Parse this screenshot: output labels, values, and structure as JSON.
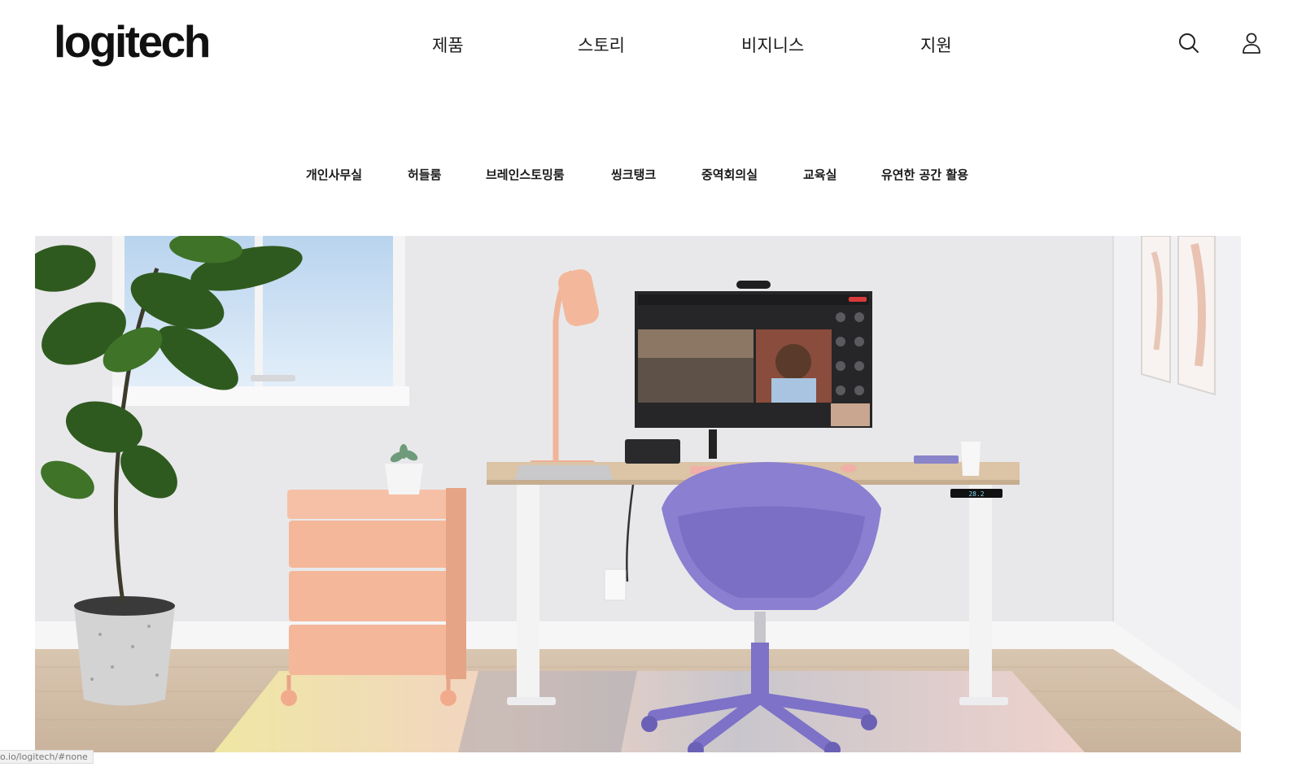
{
  "brand": {
    "logo_text": "logitech"
  },
  "main_nav": {
    "items": [
      {
        "label": "제품"
      },
      {
        "label": "스토리"
      },
      {
        "label": "비지니스"
      },
      {
        "label": "지원"
      }
    ]
  },
  "header_icons": {
    "search": "search-icon",
    "account": "user-icon"
  },
  "sub_nav": {
    "items": [
      {
        "label": "개인사무실"
      },
      {
        "label": "허들룸"
      },
      {
        "label": "브레인스토밍룸"
      },
      {
        "label": "씽크탱크"
      },
      {
        "label": "중역회의실"
      },
      {
        "label": "교육실"
      },
      {
        "label": "유연한 공간 활용"
      }
    ]
  },
  "hero": {
    "desk_display": "28.2"
  },
  "status_bar": {
    "url": "o.io/logitech/#none"
  },
  "colors": {
    "chair": "#8a7fd0",
    "drawer": "#f4b79a",
    "wall": "#e9e9ec",
    "floor": "#d8c4ad"
  }
}
